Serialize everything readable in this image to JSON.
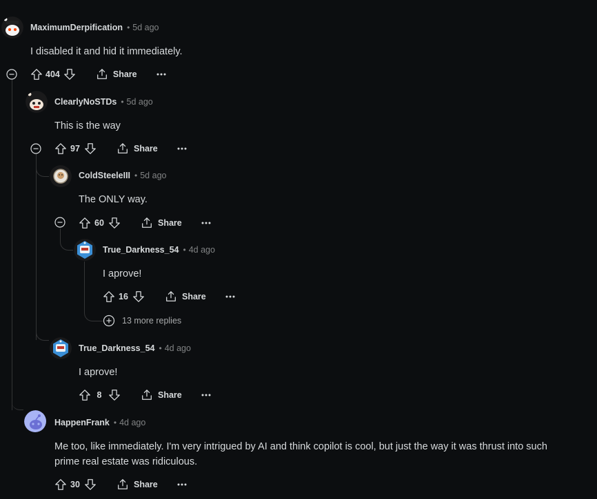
{
  "comments": [
    {
      "author": "MaximumDerpification",
      "time": "5d ago",
      "body": "I disabled it and hid it immediately.",
      "votes": "404",
      "share_label": "Share"
    },
    {
      "author": "ClearlyNoSTDs",
      "time": "5d ago",
      "body": "This is the way",
      "votes": "97",
      "share_label": "Share"
    },
    {
      "author": "ColdSteeleIII",
      "time": "5d ago",
      "body": "The ONLY way.",
      "votes": "60",
      "share_label": "Share"
    },
    {
      "author": "True_Darkness_54",
      "time": "4d ago",
      "body": "I aprove!",
      "votes": "16",
      "share_label": "Share"
    },
    {
      "author": "True_Darkness_54",
      "time": "4d ago",
      "body": "I aprove!",
      "votes": "8",
      "share_label": "Share"
    },
    {
      "author": "HappenFrank",
      "time": "4d ago",
      "body": "Me too, like immediately. I'm very intrigued by AI and think copilot is cool, but just the way it was thrust into such prime real estate was ridiculous.",
      "votes": "30",
      "share_label": "Share"
    }
  ],
  "more_replies": "13 more replies",
  "separator": "•",
  "icons": {
    "upvote": "arrow-up-icon",
    "downvote": "arrow-down-icon",
    "share": "share-icon",
    "more": "ellipsis-icon",
    "collapse": "minus-circle-icon",
    "expand": "plus-circle-icon"
  },
  "colors": {
    "background": "#0c0e10",
    "text": "#d7dadc",
    "muted": "#818384",
    "thread_line": "#343536"
  }
}
